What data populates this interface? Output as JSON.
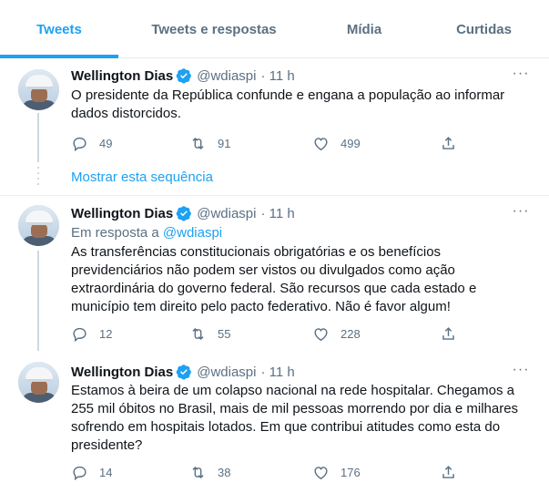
{
  "tabs": [
    "Tweets",
    "Tweets e respostas",
    "Mídia",
    "Curtidas"
  ],
  "show_thread": "Mostrar esta sequência",
  "tweets": [
    {
      "name": "Wellington Dias",
      "handle": "@wdiaspi",
      "time": "· 11 h",
      "reply_prefix": "",
      "reply_handle": "",
      "text": "O presidente da República confunde e engana a população ao informar dados distorcidos.",
      "replies": "49",
      "retweets": "91",
      "likes": "499"
    },
    {
      "name": "Wellington Dias",
      "handle": "@wdiaspi",
      "time": "· 11 h",
      "reply_prefix": "Em resposta a",
      "reply_handle": "@wdiaspi",
      "text": "As transferências constitucionais obrigatórias e os benefícios previdenciários não podem ser vistos ou divulgados como ação extraordinária do governo federal. São recursos que cada estado e município tem direito pelo pacto federativo. Não é favor algum!",
      "replies": "12",
      "retweets": "55",
      "likes": "228"
    },
    {
      "name": "Wellington Dias",
      "handle": "@wdiaspi",
      "time": "· 11 h",
      "reply_prefix": "",
      "reply_handle": "",
      "text": "Estamos à beira de um colapso nacional na rede hospitalar. Chegamos a 255 mil óbitos no Brasil, mais de mil pessoas morrendo por dia e milhares sofrendo em hospitais lotados. Em que contribui atitudes como esta do presidente?",
      "replies": "14",
      "retweets": "38",
      "likes": "176"
    }
  ],
  "colors": {
    "accent": "#1da1f2",
    "secondary_text": "#5b7083",
    "divider": "#e6ecf0",
    "primary_text": "#0f1419"
  },
  "icons": [
    "verified-badge-icon",
    "more-icon",
    "reply-icon",
    "retweet-icon",
    "like-icon",
    "share-icon"
  ]
}
